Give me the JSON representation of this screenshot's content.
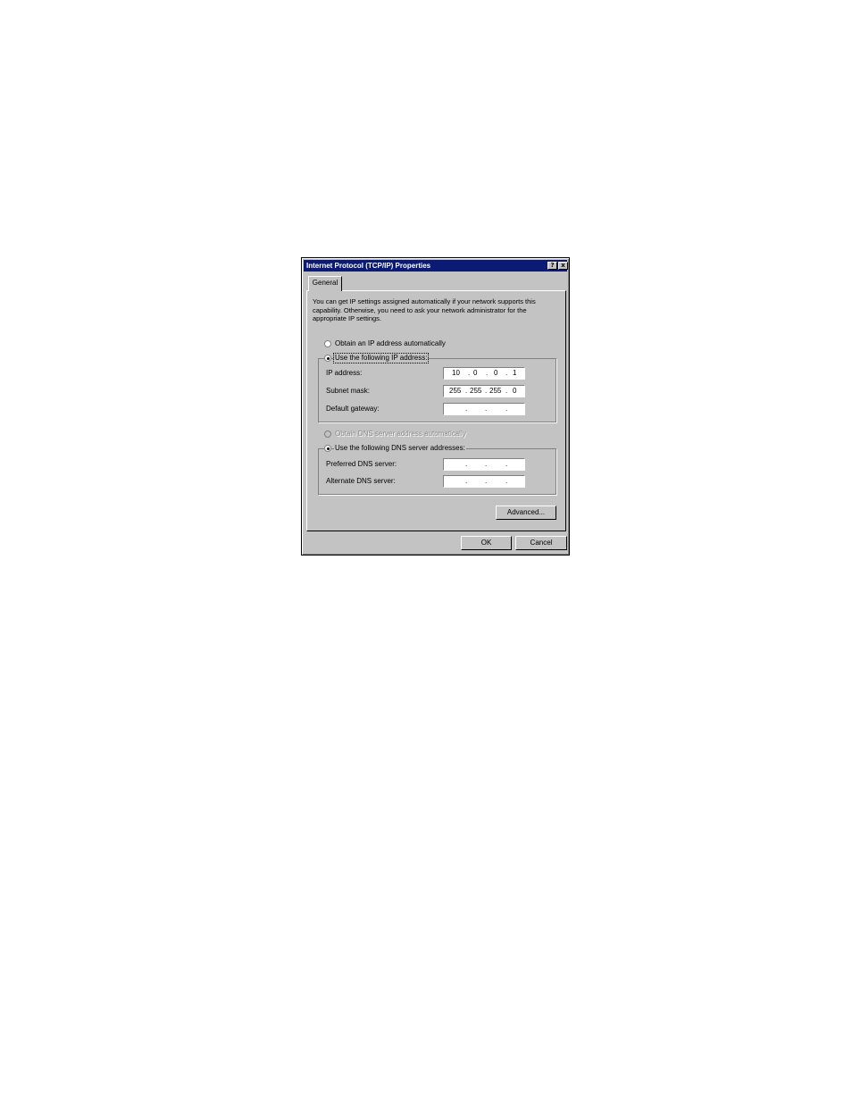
{
  "window": {
    "title": "Internet Protocol (TCP/IP) Properties",
    "help_button": "?",
    "close_button": "x"
  },
  "tabs": [
    {
      "label": "General"
    }
  ],
  "intro_text": "You can get IP settings assigned automatically if your network supports this capability. Otherwise, you need to ask your network administrator for the appropriate IP settings.",
  "ip": {
    "auto_label": "Obtain an IP address automatically",
    "manual_label": "Use the following IP address:",
    "selected": "manual",
    "fields": [
      {
        "label": "IP address:",
        "octets": [
          "10",
          "0",
          "0",
          "1"
        ]
      },
      {
        "label": "Subnet mask:",
        "octets": [
          "255",
          "255",
          "255",
          "0"
        ]
      },
      {
        "label": "Default gateway:",
        "octets": [
          "",
          "",
          "",
          ""
        ]
      }
    ]
  },
  "dns": {
    "auto_label": "Obtain DNS server address automatically",
    "manual_label": "Use the following DNS server addresses:",
    "selected": "manual",
    "fields": [
      {
        "label": "Preferred DNS server:",
        "octets": [
          "",
          "",
          "",
          ""
        ]
      },
      {
        "label": "Alternate DNS server:",
        "octets": [
          "",
          "",
          "",
          ""
        ]
      }
    ]
  },
  "buttons": {
    "advanced": "Advanced...",
    "ok": "OK",
    "cancel": "Cancel"
  },
  "colors": {
    "titlebar": "#0a1a75",
    "face": "#c3c3c3"
  }
}
